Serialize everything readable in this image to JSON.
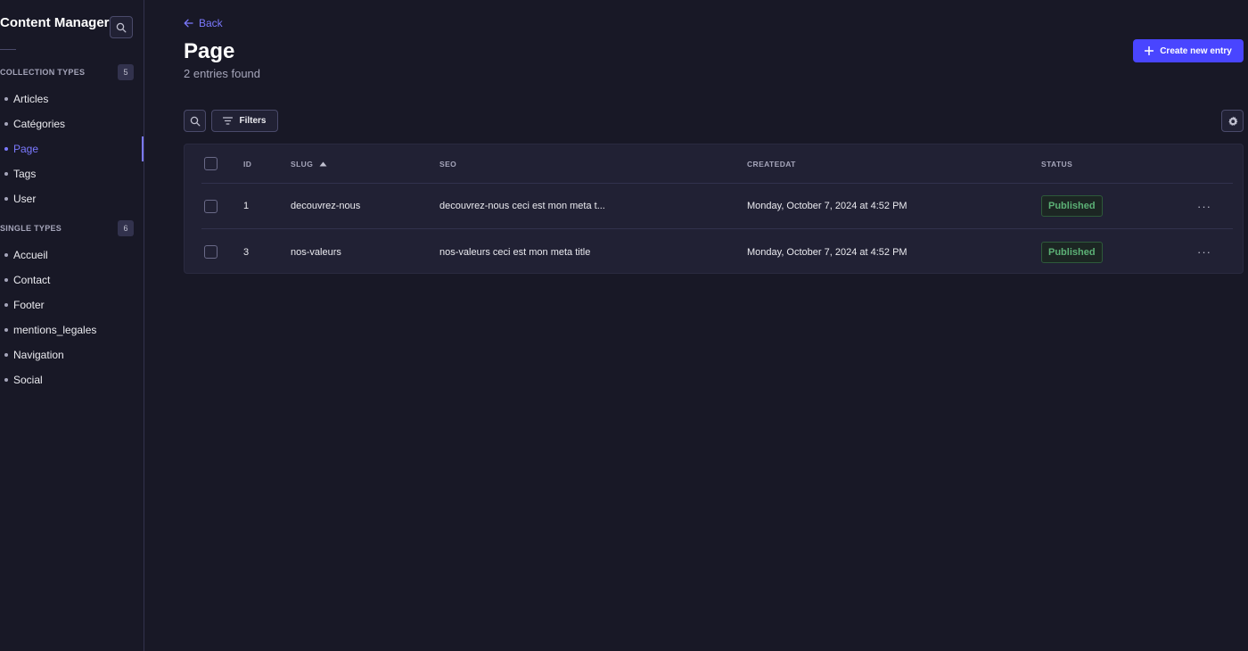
{
  "sidebar": {
    "title": "Content Manager",
    "collection_types": {
      "label": "COLLECTION TYPES",
      "count": "5",
      "items": [
        {
          "label": "Articles"
        },
        {
          "label": "Catégories"
        },
        {
          "label": "Page"
        },
        {
          "label": "Tags"
        },
        {
          "label": "User"
        }
      ]
    },
    "single_types": {
      "label": "SINGLE TYPES",
      "count": "6",
      "items": [
        {
          "label": "Accueil"
        },
        {
          "label": "Contact"
        },
        {
          "label": "Footer"
        },
        {
          "label": "mentions_legales"
        },
        {
          "label": "Navigation"
        },
        {
          "label": "Social"
        }
      ]
    },
    "active_item": "Page"
  },
  "header": {
    "back_label": "Back",
    "title": "Page",
    "subtitle": "2 entries found",
    "create_label": "Create new entry"
  },
  "toolbar": {
    "filters_label": "Filters"
  },
  "table": {
    "columns": [
      "ID",
      "SLUG",
      "SEO",
      "CREATEDAT",
      "STATUS"
    ],
    "sort_column": "SLUG",
    "sort_direction": "ascending",
    "rows": [
      {
        "id": "1",
        "slug": "decouvrez-nous",
        "seo": "decouvrez-nous ceci est mon meta t...",
        "createdat": "Monday, October 7, 2024 at 4:52 PM",
        "status": "Published"
      },
      {
        "id": "3",
        "slug": "nos-valeurs",
        "seo": "nos-valeurs ceci est mon meta title",
        "createdat": "Monday, October 7, 2024 at 4:52 PM",
        "status": "Published"
      }
    ],
    "row_actions_label": "···"
  },
  "colors": {
    "accent": "#4945ff",
    "accent_text": "#7b79ff",
    "published": "#5cb176",
    "background": "#181826",
    "surface": "#212134"
  },
  "icons": {
    "search": "search-icon",
    "back": "arrow-left-icon",
    "plus": "plus-icon",
    "filter": "filter-icon",
    "settings": "gear-icon",
    "sort": "caret-up-icon"
  }
}
